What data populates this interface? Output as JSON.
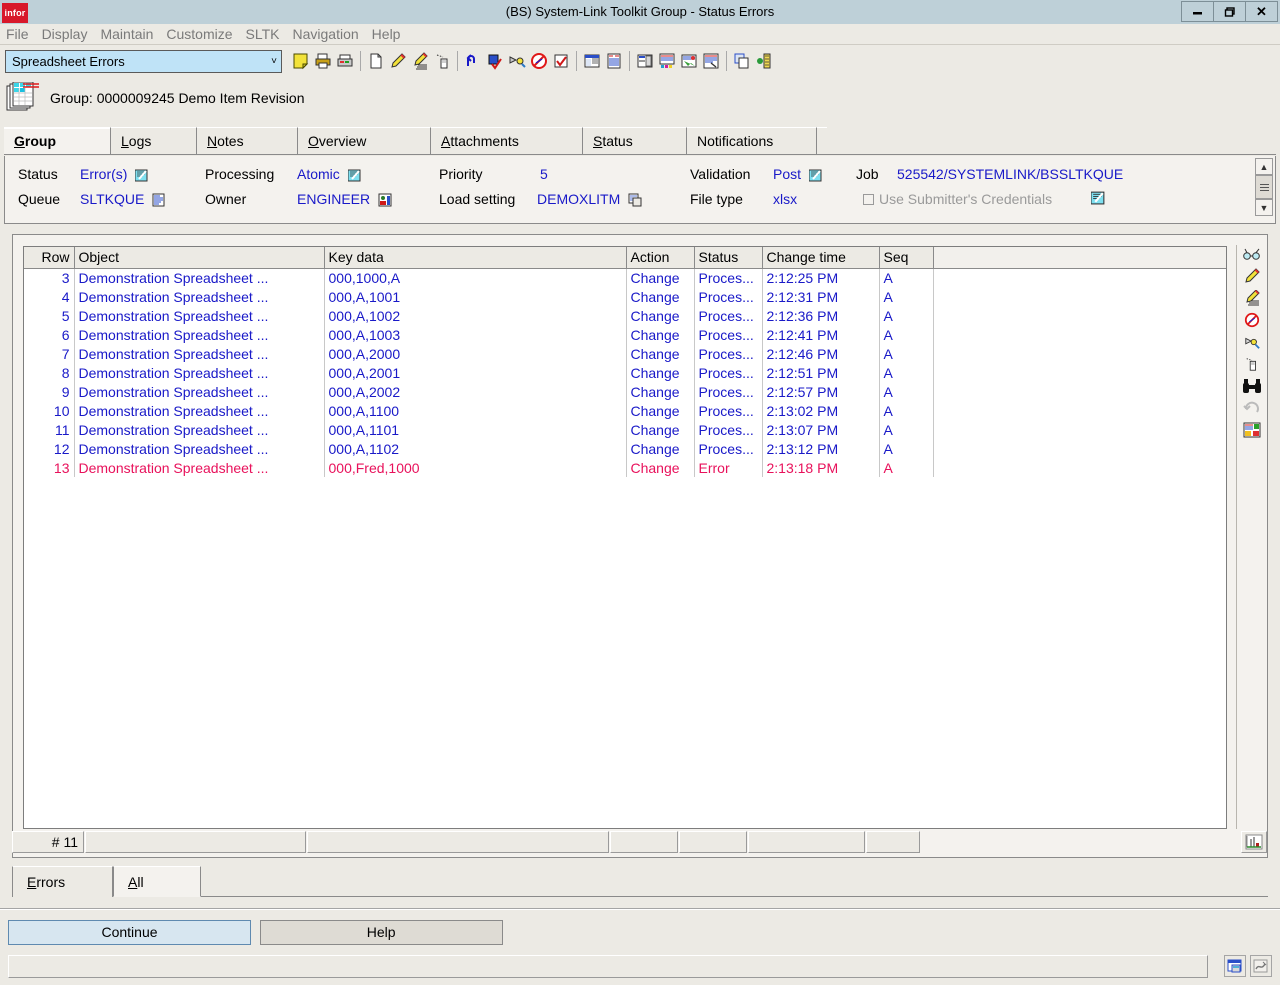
{
  "window": {
    "logo": "infor",
    "title": "(BS) System-Link Toolkit Group - Status Errors",
    "minimize_label": "—",
    "restore_label": "❐",
    "close_label": "✕"
  },
  "menubar": {
    "items": [
      "File",
      "Display",
      "Maintain",
      "Customize",
      "SLTK",
      "Navigation",
      "Help"
    ]
  },
  "toolbar": {
    "combo_value": "Spreadsheet Errors",
    "combo_caret": "˅",
    "icons": [
      "note-icon",
      "print-icon",
      "fax-icon",
      "new-document-icon",
      "edit-pencil-icon",
      "edit-lines-icon",
      "attach-clip-icon",
      "undo-icon",
      "submit-check-icon",
      "release-icon",
      "cancel-icon",
      "approve-check-icon",
      "grid-view-icon",
      "list-view-icon",
      "detail-view-icon",
      "color-grid-icon",
      "map-grid-icon",
      "report-grid-icon",
      "copy-icon",
      "launch-icon"
    ]
  },
  "group_header": {
    "icon": "spreadsheet-group-icon",
    "text": "Group: 0000009245   Demo Item Revision"
  },
  "tabs": [
    {
      "label": "Group",
      "mnemonic": "G",
      "active": true
    },
    {
      "label": "Logs",
      "mnemonic": "L",
      "active": false
    },
    {
      "label": "Notes",
      "mnemonic": "N",
      "active": false
    },
    {
      "label": "Overview",
      "mnemonic": "O",
      "active": false
    },
    {
      "label": "Attachments",
      "mnemonic": "A",
      "active": false
    },
    {
      "label": "Status",
      "mnemonic": "S",
      "active": false
    },
    {
      "label": "Notifications",
      "mnemonic": "",
      "active": false
    }
  ],
  "detail": {
    "status_label": "Status",
    "status_value": "Error(s)",
    "queue_label": "Queue",
    "queue_value": "SLTKQUE",
    "processing_label": "Processing",
    "processing_value": "Atomic",
    "owner_label": "Owner",
    "owner_value": "ENGINEER",
    "priority_label": "Priority",
    "priority_value": "5",
    "load_setting_label": "Load setting",
    "load_setting_value": "DEMOXLITM",
    "validation_label": "Validation",
    "validation_value": "Post",
    "file_type_label": "File type",
    "file_type_value": "xlsx",
    "job_label": "Job",
    "job_value": "525542/SYSTEMLINK/BSSLTKQUE",
    "credentials_label": "Use Submitter's Credentials"
  },
  "grid": {
    "columns": [
      "Row",
      "Object",
      "Key data",
      "Action",
      "Status",
      "Change time",
      "Seq",
      ""
    ],
    "rows": [
      {
        "row": "3",
        "object": "Demonstration Spreadsheet ...",
        "key": "000,1000,A",
        "action": "Change",
        "status": "Proces...",
        "time": "2:12:25 PM",
        "seq": "A",
        "error": false
      },
      {
        "row": "4",
        "object": "Demonstration Spreadsheet ...",
        "key": "000,A,1001",
        "action": "Change",
        "status": "Proces...",
        "time": "2:12:31 PM",
        "seq": "A",
        "error": false
      },
      {
        "row": "5",
        "object": "Demonstration Spreadsheet ...",
        "key": "000,A,1002",
        "action": "Change",
        "status": "Proces...",
        "time": "2:12:36 PM",
        "seq": "A",
        "error": false
      },
      {
        "row": "6",
        "object": "Demonstration Spreadsheet ...",
        "key": "000,A,1003",
        "action": "Change",
        "status": "Proces...",
        "time": "2:12:41 PM",
        "seq": "A",
        "error": false
      },
      {
        "row": "7",
        "object": "Demonstration Spreadsheet ...",
        "key": "000,A,2000",
        "action": "Change",
        "status": "Proces...",
        "time": "2:12:46 PM",
        "seq": "A",
        "error": false
      },
      {
        "row": "8",
        "object": "Demonstration Spreadsheet ...",
        "key": "000,A,2001",
        "action": "Change",
        "status": "Proces...",
        "time": "2:12:51 PM",
        "seq": "A",
        "error": false
      },
      {
        "row": "9",
        "object": "Demonstration Spreadsheet ...",
        "key": "000,A,2002",
        "action": "Change",
        "status": "Proces...",
        "time": "2:12:57 PM",
        "seq": "A",
        "error": false
      },
      {
        "row": "10",
        "object": "Demonstration Spreadsheet ...",
        "key": "000,A,1100",
        "action": "Change",
        "status": "Proces...",
        "time": "2:13:02 PM",
        "seq": "A",
        "error": false
      },
      {
        "row": "11",
        "object": "Demonstration Spreadsheet ...",
        "key": "000,A,1101",
        "action": "Change",
        "status": "Proces...",
        "time": "2:13:07 PM",
        "seq": "A",
        "error": false
      },
      {
        "row": "12",
        "object": "Demonstration Spreadsheet ...",
        "key": "000,A,1102",
        "action": "Change",
        "status": "Proces...",
        "time": "2:13:12 PM",
        "seq": "A",
        "error": false
      },
      {
        "row": "13",
        "object": "Demonstration Spreadsheet ...",
        "key": "000,Fred,1000",
        "action": "Change",
        "status": "Error",
        "time": "2:13:18 PM",
        "seq": "A",
        "error": true
      }
    ],
    "rail_icons": [
      "view-glasses-icon",
      "edit-pencil-icon",
      "edit-lines-icon",
      "cancel-icon",
      "release-icon",
      "attach-clip-icon",
      "find-binoculars-icon",
      "refresh-icon",
      "report-grid-icon"
    ]
  },
  "statusbar": {
    "count": "# 11",
    "chart_icon": "chart-icon"
  },
  "lower_tabs": [
    {
      "label": "Errors",
      "mnemonic": "E",
      "active": false
    },
    {
      "label": "All",
      "mnemonic": "A",
      "active": true
    }
  ],
  "buttons": {
    "continue": "Continue",
    "help": "Help"
  },
  "bottom": {
    "message": "",
    "icons": [
      "window-icon",
      "signature-icon"
    ]
  },
  "colors": {
    "titlebar": "#bed0d8",
    "accent_blue": "#1919c8",
    "error_pink": "#e8115b",
    "combo_bg": "#bfe3f7",
    "face": "#eceae4",
    "logo_red": "#d8182a"
  }
}
